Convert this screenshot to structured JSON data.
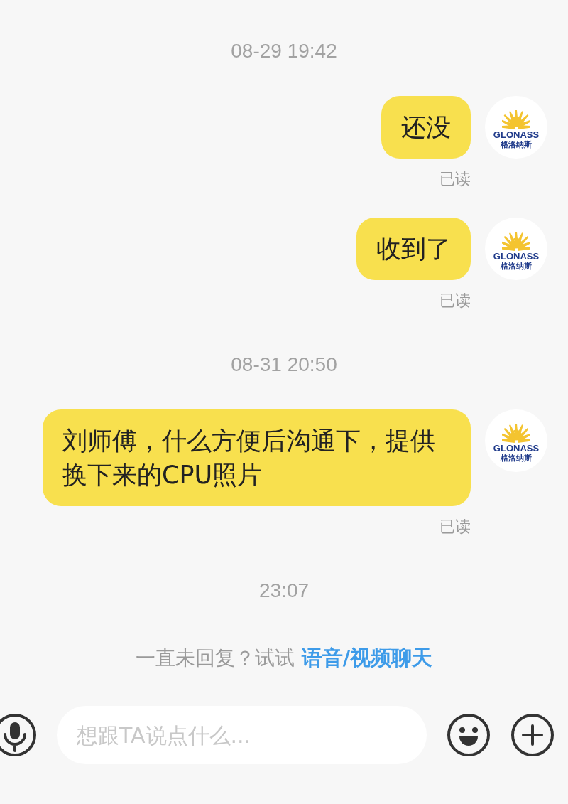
{
  "conversation": [
    {
      "kind": "time",
      "text": "08-29 19:42"
    },
    {
      "kind": "message",
      "text": "还没",
      "read_status": "已读",
      "avatar": {
        "wordmark": "GLONASS",
        "name": "格洛纳斯"
      }
    },
    {
      "kind": "message",
      "text": "收到了",
      "read_status": "已读",
      "avatar": {
        "wordmark": "GLONASS",
        "name": "格洛纳斯"
      }
    },
    {
      "kind": "time",
      "text": "08-31 20:50"
    },
    {
      "kind": "message",
      "text": "刘师傅，什么方便后沟通下，提供换下来的CPU照片",
      "read_status": "已读",
      "avatar": {
        "wordmark": "GLONASS",
        "name": "格洛纳斯"
      }
    },
    {
      "kind": "time",
      "text": "23:07"
    }
  ],
  "hint": {
    "text": "一直未回复？试试",
    "link": "语音/视频聊天"
  },
  "composer": {
    "placeholder": "想跟TA说点什么..."
  }
}
